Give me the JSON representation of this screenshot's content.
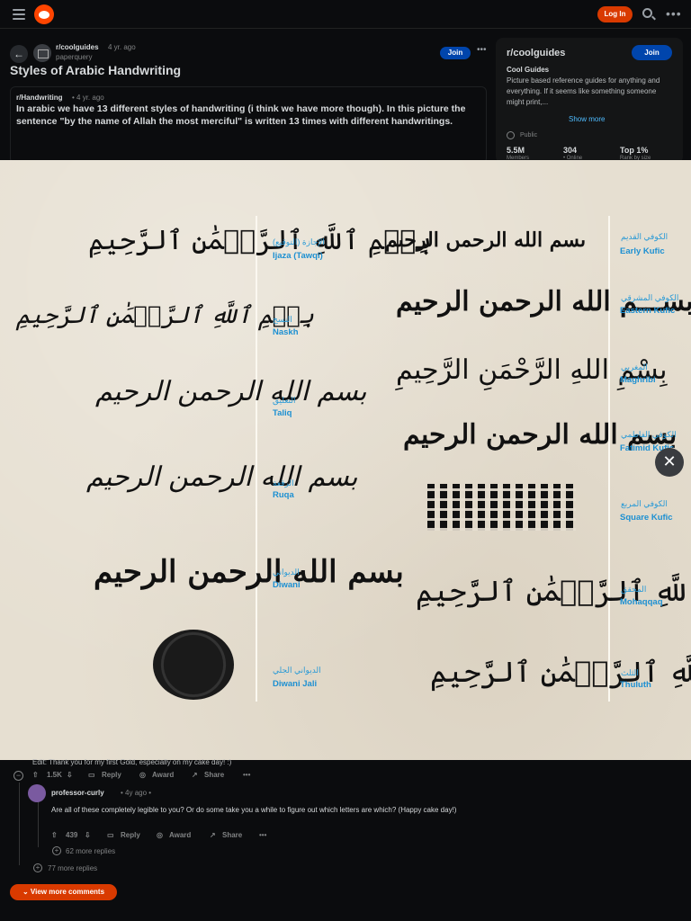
{
  "topbar": {
    "login_label": "Log In"
  },
  "post": {
    "subreddit": "r/coolguides",
    "age": "4 yr. ago",
    "username": "paperquery",
    "join_label": "Join",
    "title": "Styles of Arabic Handwriting"
  },
  "comment1": {
    "user": "r/Handwriting",
    "age": "• 4 yr. ago",
    "body": "In arabic we have 13 different styles of handwriting (i think we have more though). In this picture the sentence \"by the name of Allah the most merciful\" is written 13 times with different handwritings."
  },
  "sidebar": {
    "title": "r/coolguides",
    "join_label": "Join",
    "heading": "Cool Guides",
    "description": "Picture based reference guides for anything and everything. If it seems like something someone might print,...",
    "show_more": "Show more",
    "public": "Public",
    "stats": [
      {
        "value": "5.5M",
        "label": "Members"
      },
      {
        "value": "304",
        "label": "• Online"
      },
      {
        "value": "Top 1%",
        "label": "Rank by size"
      }
    ]
  },
  "image": {
    "styles": [
      {
        "ar": "الإجازة (التوقيع)",
        "en": "Ijaza (Tawqi)",
        "script": "بِسۡمِ ٱللَّهِ ٱلرَّحۡمَٰنِ ٱلرَّحِيمِ"
      },
      {
        "ar": "النسخ",
        "en": "Naskh",
        "script": "بِسۡمِ ٱللَّهِ ٱلرَّحۡمَٰنِ ٱلرَّحِيمِ"
      },
      {
        "ar": "التعليق",
        "en": "Taliq",
        "script": "بسم الله الرحمن الرحيم"
      },
      {
        "ar": "الرقعة",
        "en": "Ruqa",
        "script": "بسم الله الرحمن الرحيم"
      },
      {
        "ar": "الديواني",
        "en": "Diwani",
        "script": "بسم الله الرحمن الرحيم"
      },
      {
        "ar": "الديواني الجلي",
        "en": "Diwani Jali",
        "script": ""
      },
      {
        "ar": "الكوفي القديم",
        "en": "Early Kufic",
        "script": "ٮسم الله الرحمں الرحىم"
      },
      {
        "ar": "الكوفي المشرقي",
        "en": "Eastern Kufic",
        "script": "بســـم الله الرحمن الرحيم"
      },
      {
        "ar": "المغربي",
        "en": "Maghribi",
        "script": "بِسْمِ اللهِ الرَّحْمَنِ الرَّحِيمِ"
      },
      {
        "ar": "الكوفي الفاطمي",
        "en": "Fatimid Kufic",
        "script": "بسم الله الرحمن الرحيم"
      },
      {
        "ar": "الكوفي المربع",
        "en": "Square Kufic",
        "script": ""
      },
      {
        "ar": "المحقق",
        "en": "Mohaqqaq",
        "script": "بِسۡمِ ٱللَّهِ ٱلرَّحۡمَٰنِ ٱلرَّحِيمِ"
      },
      {
        "ar": "الثلث",
        "en": "Thuluth",
        "script": "بِسۡمِ ٱللَّهِ ٱلرَّحۡمَٰنِ ٱلرَّحِيمِ"
      }
    ]
  },
  "bottom": {
    "edit_text": "Edit: Thank you for my first Gold, especially on my cake day! :)",
    "c1_votes": "1.5K",
    "reply": "Reply",
    "award": "Award",
    "share": "Share",
    "c2_user": "professor-curly",
    "c2_age": "• 4y ago •",
    "c2_body": "Are all of these completely legible to you? Or do some take you a while to figure out which letters are which? (Happy cake day!)",
    "c2_votes": "439",
    "more_replies_a": "62 more replies",
    "more_replies_b": "77 more replies",
    "view_more": "View more comments"
  },
  "colors": {
    "accent": "#d93a00",
    "join": "#0045ac",
    "label_blue": "#1d90d2"
  }
}
